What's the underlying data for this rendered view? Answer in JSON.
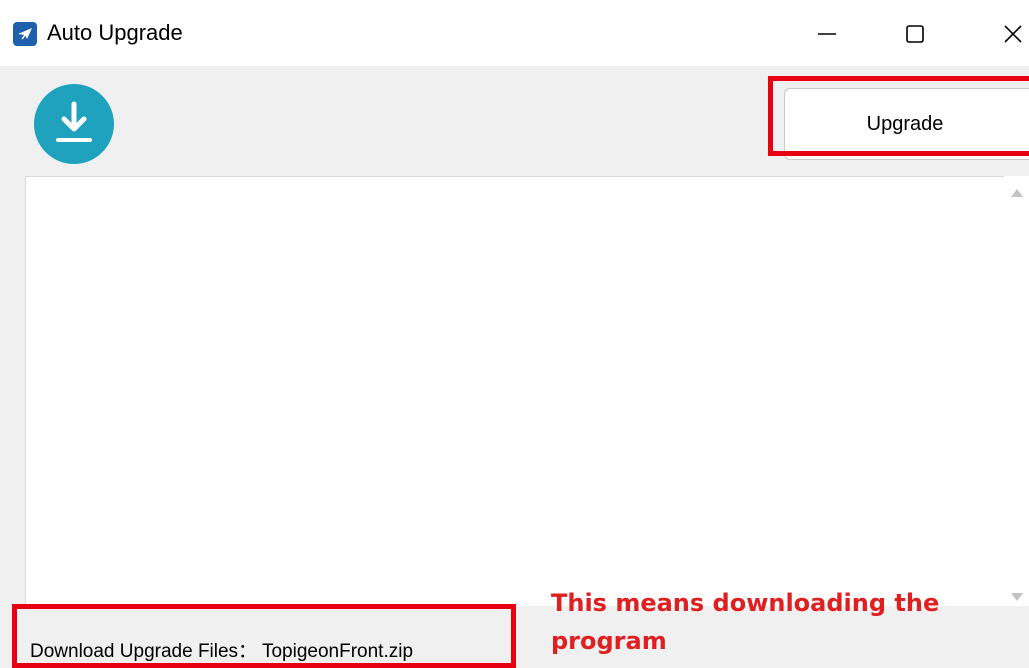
{
  "window": {
    "title": "Auto Upgrade",
    "app_icon": "pigeon-app-icon",
    "controls": {
      "minimize_icon": "minimize-icon",
      "maximize_icon": "maximize-icon",
      "close_icon": "close-icon"
    }
  },
  "toolbar": {
    "download_icon": "download-icon",
    "upgrade_label": "Upgrade"
  },
  "log": {
    "content": ""
  },
  "status": {
    "text": "Download Upgrade Files： TopigeonFront.zip"
  },
  "annotation": {
    "text": "This means downloading the program"
  },
  "colors": {
    "highlight": "#e60012",
    "annotation": "#e02020",
    "download_circle": "#1fa2bd",
    "app_icon": "#1e5fae"
  }
}
